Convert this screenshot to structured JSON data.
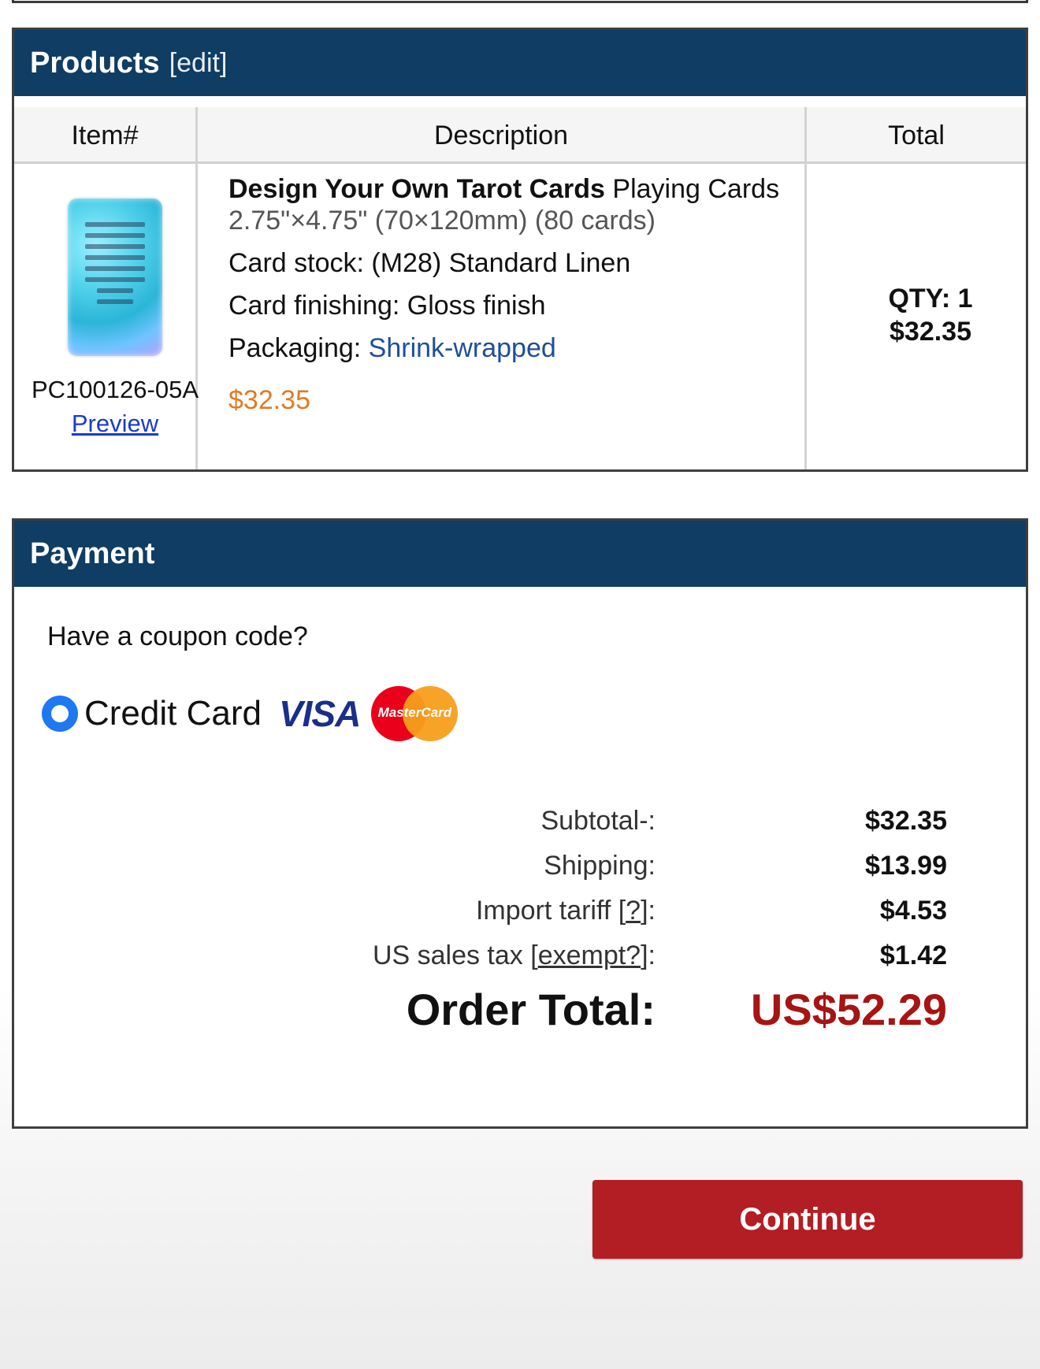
{
  "products": {
    "header_title": "Products",
    "header_edit": "[edit]",
    "columns": [
      "Item#",
      "Description",
      "Total"
    ],
    "item": {
      "code": "PC100126-05A",
      "preview_label": "Preview",
      "title_bold": "Design Your Own Tarot Cards",
      "title_rest": " Playing Cards",
      "size": "2.75\"×4.75\" (70×120mm) (80 cards)",
      "card_stock": "Card stock: (M28) Standard Linen",
      "card_finishing": "Card finishing: Gloss finish",
      "packaging_label": "Packaging: ",
      "packaging_value": "Shrink-wrapped",
      "price": "$32.35",
      "qty": "QTY: 1",
      "total": "$32.35"
    }
  },
  "payment": {
    "header_title": "Payment",
    "coupon_prompt": "Have a coupon code?",
    "method_label": "Credit Card",
    "visa_label": "VISA",
    "mastercard_label": "MasterCard",
    "summary": {
      "subtotal_label": "Subtotal-:",
      "subtotal_value": "$32.35",
      "shipping_label": "Shipping:",
      "shipping_value": "$13.99",
      "tariff_label_prefix": "Import tariff [",
      "tariff_link": "?",
      "tariff_label_suffix": "]:",
      "tariff_value": "$4.53",
      "tax_label_prefix": "US sales tax [",
      "tax_link": "exempt?",
      "tax_label_suffix": "]:",
      "tax_value": "$1.42",
      "order_total_label": "Order Total:",
      "order_total_value": "US$52.29"
    }
  },
  "continue_label": "Continue"
}
